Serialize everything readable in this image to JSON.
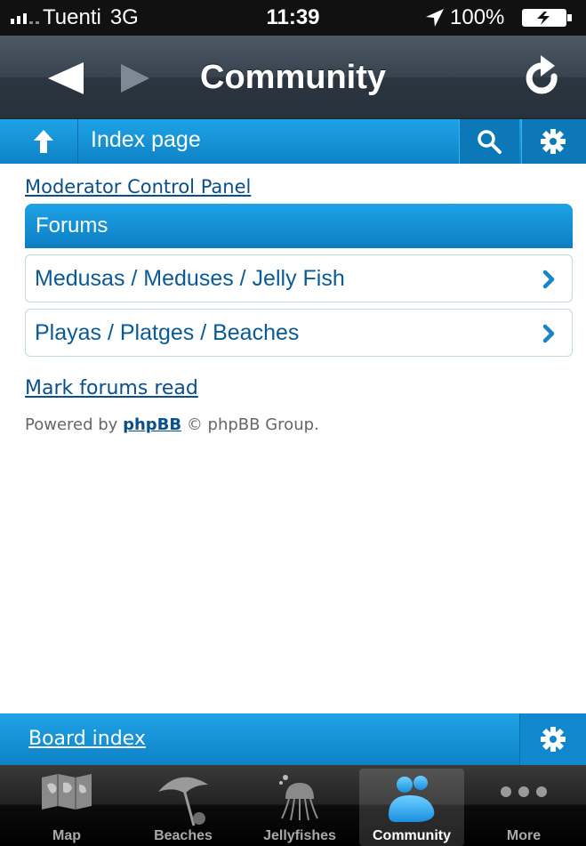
{
  "status_bar": {
    "carrier": "Tuenti",
    "network": "3G",
    "time": "11:39",
    "battery": "100%"
  },
  "nav_bar": {
    "title": "Community"
  },
  "board_header": {
    "title": "Index page"
  },
  "content": {
    "mcp_link": "Moderator Control Panel",
    "forums_header": "Forums",
    "forums": [
      {
        "label": "Medusas / Meduses / Jelly Fish"
      },
      {
        "label": "Playas / Platges / Beaches"
      }
    ],
    "mark_read_link": "Mark forums read",
    "powered_prefix": "Powered by",
    "powered_link": "phpBB",
    "powered_suffix": "© phpBB Group."
  },
  "bottom_bar": {
    "board_index": "Board index"
  },
  "tab_bar": {
    "tabs": [
      {
        "label": "Map",
        "icon": "map-icon",
        "active": false
      },
      {
        "label": "Beaches",
        "icon": "umbrella-icon",
        "active": false
      },
      {
        "label": "Jellyfishes",
        "icon": "jellyfish-icon",
        "active": false
      },
      {
        "label": "Community",
        "icon": "people-icon",
        "active": true
      },
      {
        "label": "More",
        "icon": "more-dots-icon",
        "active": false
      }
    ]
  },
  "colors": {
    "accent_blue": "#1ea3e6",
    "link_blue": "#0b4f8a",
    "nav_dark": "#37434e"
  }
}
